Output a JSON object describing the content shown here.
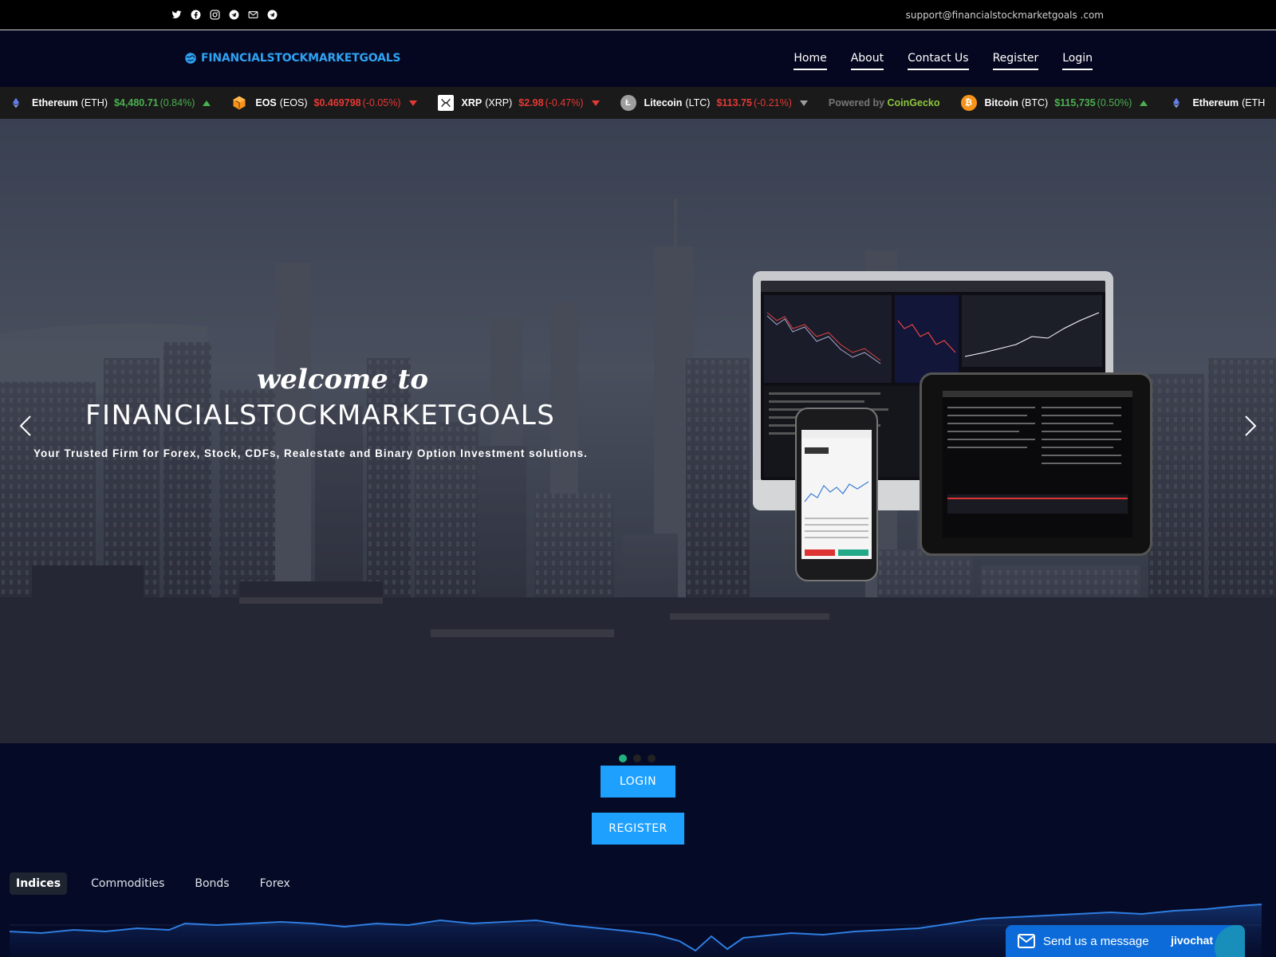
{
  "topbar": {
    "email": "support@financialstockmarketgoals .com",
    "socials": [
      "twitter-icon",
      "facebook-icon",
      "instagram-icon",
      "telegram-icon",
      "mail-icon",
      "telegram-icon"
    ]
  },
  "nav": {
    "brand": "FINANCIALSTOCKMARKETGOALS",
    "items": [
      {
        "label": "Home"
      },
      {
        "label": "About"
      },
      {
        "label": "Contact Us"
      },
      {
        "label": "Register"
      },
      {
        "label": "Login"
      }
    ]
  },
  "ticker": {
    "items": [
      {
        "name": "Ethereum",
        "symbol": "(ETH)",
        "price": "$4,480.71",
        "change": "(0.84%)",
        "direction": "up",
        "icon": "ethereum-icon",
        "color": "#627eea"
      },
      {
        "name": "EOS",
        "symbol": "(EOS)",
        "price": "$0.469798",
        "change": "(-0.05%)",
        "direction": "down",
        "icon": "eos-icon",
        "color": "#f7931a"
      },
      {
        "name": "XRP",
        "symbol": "(XRP)",
        "price": "$2.98",
        "change": "(-0.47%)",
        "direction": "down",
        "icon": "xrp-icon",
        "color": "#ffffff"
      },
      {
        "name": "Litecoin",
        "symbol": "(LTC)",
        "price": "$113.75",
        "change": "(-0.21%)",
        "direction": "down",
        "icon": "litecoin-icon",
        "color": "#9e9e9e"
      },
      {
        "name": "Bitcoin",
        "symbol": "(BTC)",
        "price": "$115,735",
        "change": "(0.50%)",
        "direction": "up",
        "icon": "bitcoin-icon",
        "color": "#f7931a"
      },
      {
        "name": "Ethereum",
        "symbol": "(ETH",
        "price": "",
        "change": "",
        "direction": "",
        "icon": "ethereum-icon",
        "color": "#627eea"
      }
    ],
    "powered_prefix": "Powered by ",
    "powered_brand": "CoinGecko"
  },
  "hero": {
    "welcome": "welcome to",
    "title": "FINANCIALSTOCKMARKETGOALS",
    "subtitle": "Your Trusted Firm for Forex, Stock, CDFs, Realestate and Binary Option Investment solutions.",
    "slides_total": 3,
    "active_slide": 1
  },
  "buttons": {
    "login": "LOGIN",
    "register": "REGISTER"
  },
  "tabs": [
    {
      "label": "Indices",
      "active": true
    },
    {
      "label": "Commodities",
      "active": false
    },
    {
      "label": "Bonds",
      "active": false
    },
    {
      "label": "Forex",
      "active": false
    }
  ],
  "chat": {
    "label": "Send us a message",
    "brand": "jivochat"
  },
  "colors": {
    "accent": "#1ea0ff",
    "brand": "#2ea3f2",
    "up": "#4caf50",
    "down": "#e53935",
    "dot_active": "#21b37f"
  }
}
